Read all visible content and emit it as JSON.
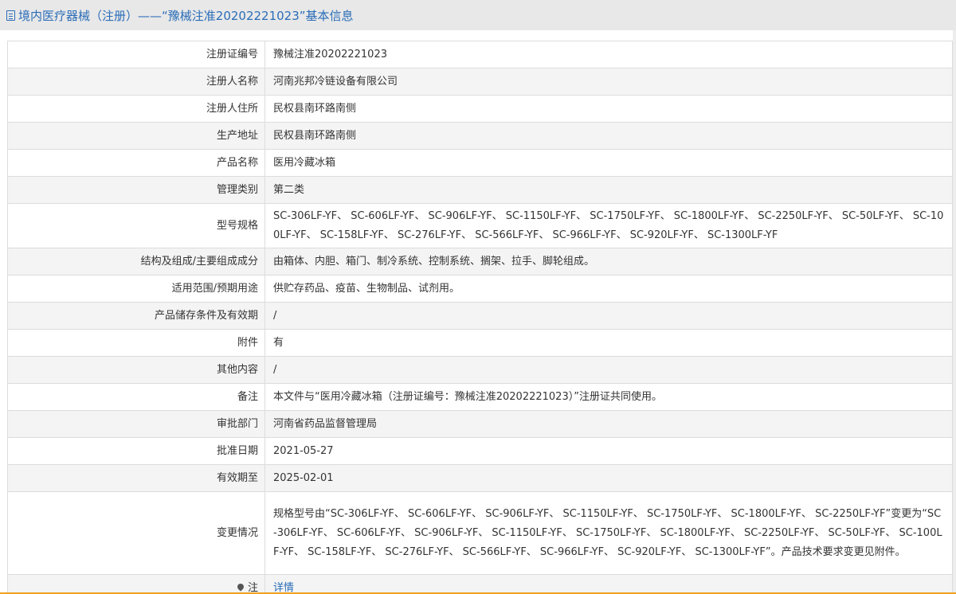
{
  "header": {
    "title": "境内医疗器械（注册）——“豫械注准20202221023”基本信息"
  },
  "rows": [
    {
      "key": "注册证编号",
      "value": "豫械注准20202221023"
    },
    {
      "key": "注册人名称",
      "value": "河南兆邦冷链设备有限公司"
    },
    {
      "key": "注册人住所",
      "value": "民权县南环路南侧"
    },
    {
      "key": "生产地址",
      "value": "民权县南环路南侧"
    },
    {
      "key": "产品名称",
      "value": "医用冷藏冰箱"
    },
    {
      "key": "管理类别",
      "value": "第二类"
    },
    {
      "key": "型号规格",
      "value": "SC-306LF-YF、 SC-606LF-YF、 SC-906LF-YF、 SC-1150LF-YF、 SC-1750LF-YF、 SC-1800LF-YF、 SC-2250LF-YF、 SC-50LF-YF、 SC-100LF-YF、 SC-158LF-YF、 SC-276LF-YF、 SC-566LF-YF、 SC-966LF-YF、 SC-920LF-YF、 SC-1300LF-YF"
    },
    {
      "key": "结构及组成/主要组成成分",
      "value": "由箱体、内胆、箱门、制冷系统、控制系统、搁架、拉手、脚轮组成。"
    },
    {
      "key": "适用范围/预期用途",
      "value": "供贮存药品、疫苗、生物制品、试剂用。"
    },
    {
      "key": "产品储存条件及有效期",
      "value": "/"
    },
    {
      "key": "附件",
      "value": "有"
    },
    {
      "key": "其他内容",
      "value": "/"
    },
    {
      "key": "备注",
      "value": "本文件与“医用冷藏冰箱（注册证编号：豫械注准20202221023）”注册证共同使用。"
    },
    {
      "key": "审批部门",
      "value": "河南省药品监督管理局"
    },
    {
      "key": "批准日期",
      "value": "2021-05-27"
    },
    {
      "key": "有效期至",
      "value": "2025-02-01"
    },
    {
      "key": "变更情况",
      "value": "规格型号由“SC-306LF-YF、 SC-606LF-YF、 SC-906LF-YF、 SC-1150LF-YF、 SC-1750LF-YF、 SC-1800LF-YF、 SC-2250LF-YF”变更为“SC-306LF-YF、 SC-606LF-YF、 SC-906LF-YF、 SC-1150LF-YF、 SC-1750LF-YF、 SC-1800LF-YF、 SC-2250LF-YF、 SC-50LF-YF、 SC-100LF-YF、 SC-158LF-YF、 SC-276LF-YF、 SC-566LF-YF、 SC-966LF-YF、 SC-920LF-YF、 SC-1300LF-YF”。产品技术要求变更见附件。"
    }
  ],
  "note_row": {
    "key": "注",
    "value": "详情",
    "icon": "pin-icon"
  },
  "colors": {
    "link": "#2a6db8",
    "header_bg": "#e8e8e8",
    "border": "#dcdcdc",
    "accent_line": "#f0a020"
  }
}
